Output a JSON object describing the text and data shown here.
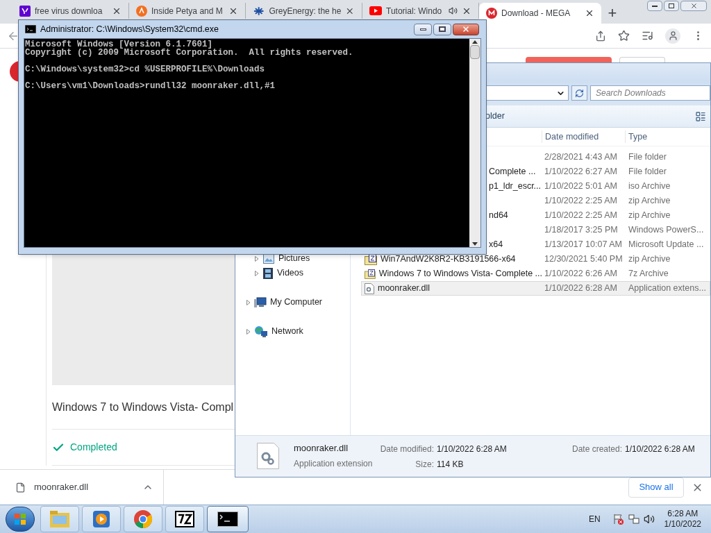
{
  "browser": {
    "tabs": [
      {
        "title": "free virus downloa",
        "kind": "yahoo",
        "selected": false,
        "audio": false
      },
      {
        "title": "Inside Petya and M",
        "kind": "avast",
        "selected": false,
        "audio": false
      },
      {
        "title": "GreyEnergy: the he",
        "kind": "sprite",
        "selected": false,
        "audio": false
      },
      {
        "title": "Tutorial: Windo",
        "kind": "youtube",
        "selected": false,
        "audio": true
      },
      {
        "title": "Download - MEGA",
        "kind": "mega",
        "selected": true,
        "audio": false
      }
    ],
    "new_tab": "+",
    "page": {
      "card_title": "Windows 7 to Windows Vista- Compl",
      "status": "Completed"
    },
    "download_shelf": {
      "file": "moonraker.dll",
      "show_all": "Show all"
    }
  },
  "explorer": {
    "search_placeholder": "Search Downloads",
    "toolbar_text": "older",
    "columns": [
      "Date modified",
      "Type"
    ],
    "rows": [
      {
        "kind": "hidden",
        "date": "2/28/2021 4:43 AM",
        "type": "File folder",
        "selected": false
      },
      {
        "kind": "partial",
        "name": "Complete ...",
        "date": "1/10/2022 6:27 AM",
        "type": "File folder",
        "selected": false
      },
      {
        "kind": "partial",
        "name": "p1_ldr_escr...",
        "date": "1/10/2022 5:01 AM",
        "type": "iso Archive",
        "selected": false
      },
      {
        "kind": "hidden",
        "date": "1/10/2022 2:25 AM",
        "type": "zip Archive",
        "selected": false
      },
      {
        "kind": "partial",
        "name": "nd64",
        "date": "1/10/2022 2:25 AM",
        "type": "zip Archive",
        "selected": false
      },
      {
        "kind": "hidden",
        "date": "1/18/2017 3:25 PM",
        "type": "Windows PowerS...",
        "selected": false
      },
      {
        "kind": "partial",
        "name": "x64",
        "date": "1/13/2017 10:07 AM",
        "type": "Microsoft Update ...",
        "selected": false
      },
      {
        "kind": "archive",
        "name": "Win7AndW2K8R2-KB3191566-x64",
        "date": "12/30/2021 5:40 PM",
        "type": "zip Archive",
        "selected": false
      },
      {
        "kind": "archive",
        "name": "Windows 7 to Windows Vista- Complete ...",
        "date": "1/10/2022 6:26 AM",
        "type": "7z Archive",
        "selected": false
      },
      {
        "kind": "extension",
        "name": "moonraker.dll",
        "date": "1/10/2022 6:28 AM",
        "type": "Application extens...",
        "selected": true
      }
    ],
    "nav": [
      {
        "children": [
          {
            "kind": "pictures",
            "label": "Pictures"
          },
          {
            "kind": "videos",
            "label": "Videos"
          }
        ]
      },
      {
        "kind": "computer",
        "label": "My Computer"
      },
      {
        "kind": "network",
        "label": "Network"
      }
    ],
    "details": {
      "name": "moonraker.dll",
      "type": "Application extension",
      "modified_label": "Date modified:",
      "modified": "1/10/2022 6:28 AM",
      "created_label": "Date created:",
      "created": "1/10/2022 6:28 AM",
      "size_label": "Size:",
      "size": "114 KB"
    }
  },
  "cmd": {
    "title": "Administrator: C:\\Windows\\System32\\cmd.exe",
    "paragraphs": [
      {
        "lines": [
          "Microsoft Windows [Version 6.1.7601]",
          "Copyright (c) 2009 Microsoft Corporation.  All rights reserved."
        ]
      },
      {
        "lines": [
          "C:\\Windows\\system32>cd %USERPROFILE%\\Downloads"
        ]
      },
      {
        "lines": [
          "C:\\Users\\vm1\\Downloads>rundll32 moonraker.dll,#1"
        ]
      }
    ]
  },
  "taskbar": {
    "apps": [
      {
        "kind": "explorer",
        "selected": false
      },
      {
        "kind": "media",
        "selected": false
      },
      {
        "kind": "chrome",
        "selected": false
      },
      {
        "kind": "sevenzip",
        "selected": false
      },
      {
        "kind": "cmd",
        "selected": true
      }
    ],
    "language": "EN",
    "time": "6:28 AM",
    "date": "1/10/2022"
  }
}
